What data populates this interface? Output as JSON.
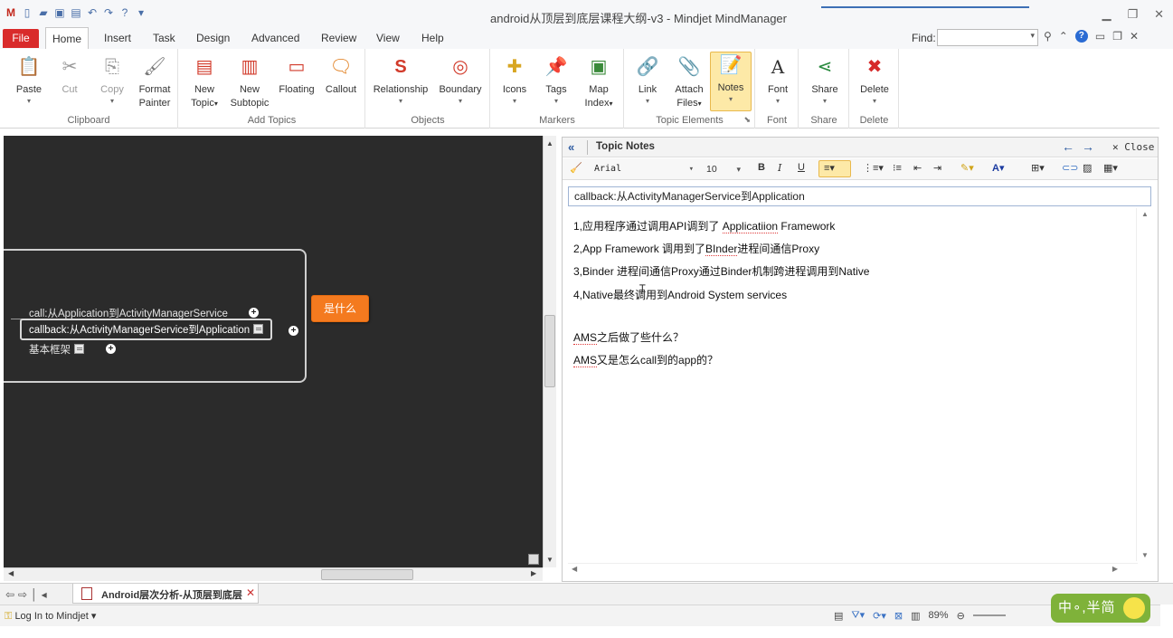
{
  "window": {
    "title": "android从顶层到底层课程大纲-v3 - Mindjet MindManager",
    "controls": [
      "minimize",
      "restore",
      "close"
    ]
  },
  "ribbon_tabs": [
    "File",
    "Home",
    "Insert",
    "Task",
    "Design",
    "Advanced",
    "Review",
    "View",
    "Help"
  ],
  "active_tab": "Home",
  "find": {
    "label": "Find:",
    "value": ""
  },
  "ribbon": {
    "clipboard": {
      "label": "Clipboard",
      "paste": "Paste",
      "cut": "Cut",
      "copy": "Copy",
      "format_painter_1": "Format",
      "format_painter_2": "Painter"
    },
    "add_topics": {
      "label": "Add Topics",
      "new_topic_1": "New",
      "new_topic_2": "Topic",
      "new_subtopic_1": "New",
      "new_subtopic_2": "Subtopic",
      "floating": "Floating",
      "callout": "Callout"
    },
    "objects": {
      "label": "Objects",
      "relationship": "Relationship",
      "boundary": "Boundary"
    },
    "markers": {
      "label": "Markers",
      "icons": "Icons",
      "tags": "Tags",
      "map_index_1": "Map",
      "map_index_2": "Index"
    },
    "topic_elements": {
      "label": "Topic Elements",
      "link": "Link",
      "attach_1": "Attach",
      "attach_2": "Files",
      "notes": "Notes"
    },
    "font": {
      "label": "Font",
      "font": "Font"
    },
    "share": {
      "label": "Share",
      "share": "Share"
    },
    "delete": {
      "label": "Delete",
      "delete": "Delete"
    }
  },
  "map": {
    "subtopics": {
      "call": "call:从Application到ActivityManagerService",
      "callback": "callback:从ActivityManagerService到Application",
      "framework": "基本框架"
    },
    "central_node": "是什么"
  },
  "notes": {
    "header_title": "Topic Notes",
    "close_label": "Close",
    "font_name": "Arial",
    "font_size": "10",
    "topic_title": "callback:从ActivityManagerService到Application",
    "lines": {
      "l1_a": "1,应用程序通过调用API调到了 ",
      "l1_b": "Applicatiion",
      "l1_c": " Framework",
      "l2_a": "2,App Framework 调用到了",
      "l2_b": "BInder",
      "l2_c": "进程间通信Proxy",
      "l3": "3,Binder 进程间通信Proxy通过Binder机制跨进程调用到Native",
      "l4": "4,Native最终调用到Android System services",
      "l5_a": "AMS",
      "l5_b": "之后做了些什么？",
      "l6_a": "AMS",
      "l6_b": "又是怎么call到的app的？"
    }
  },
  "doc_tab": {
    "label": "Android层次分析-从顶层到底层"
  },
  "status": {
    "login": "Log In to Mindjet",
    "zoom": "89%"
  },
  "ime": {
    "label": "中∘,半简"
  }
}
